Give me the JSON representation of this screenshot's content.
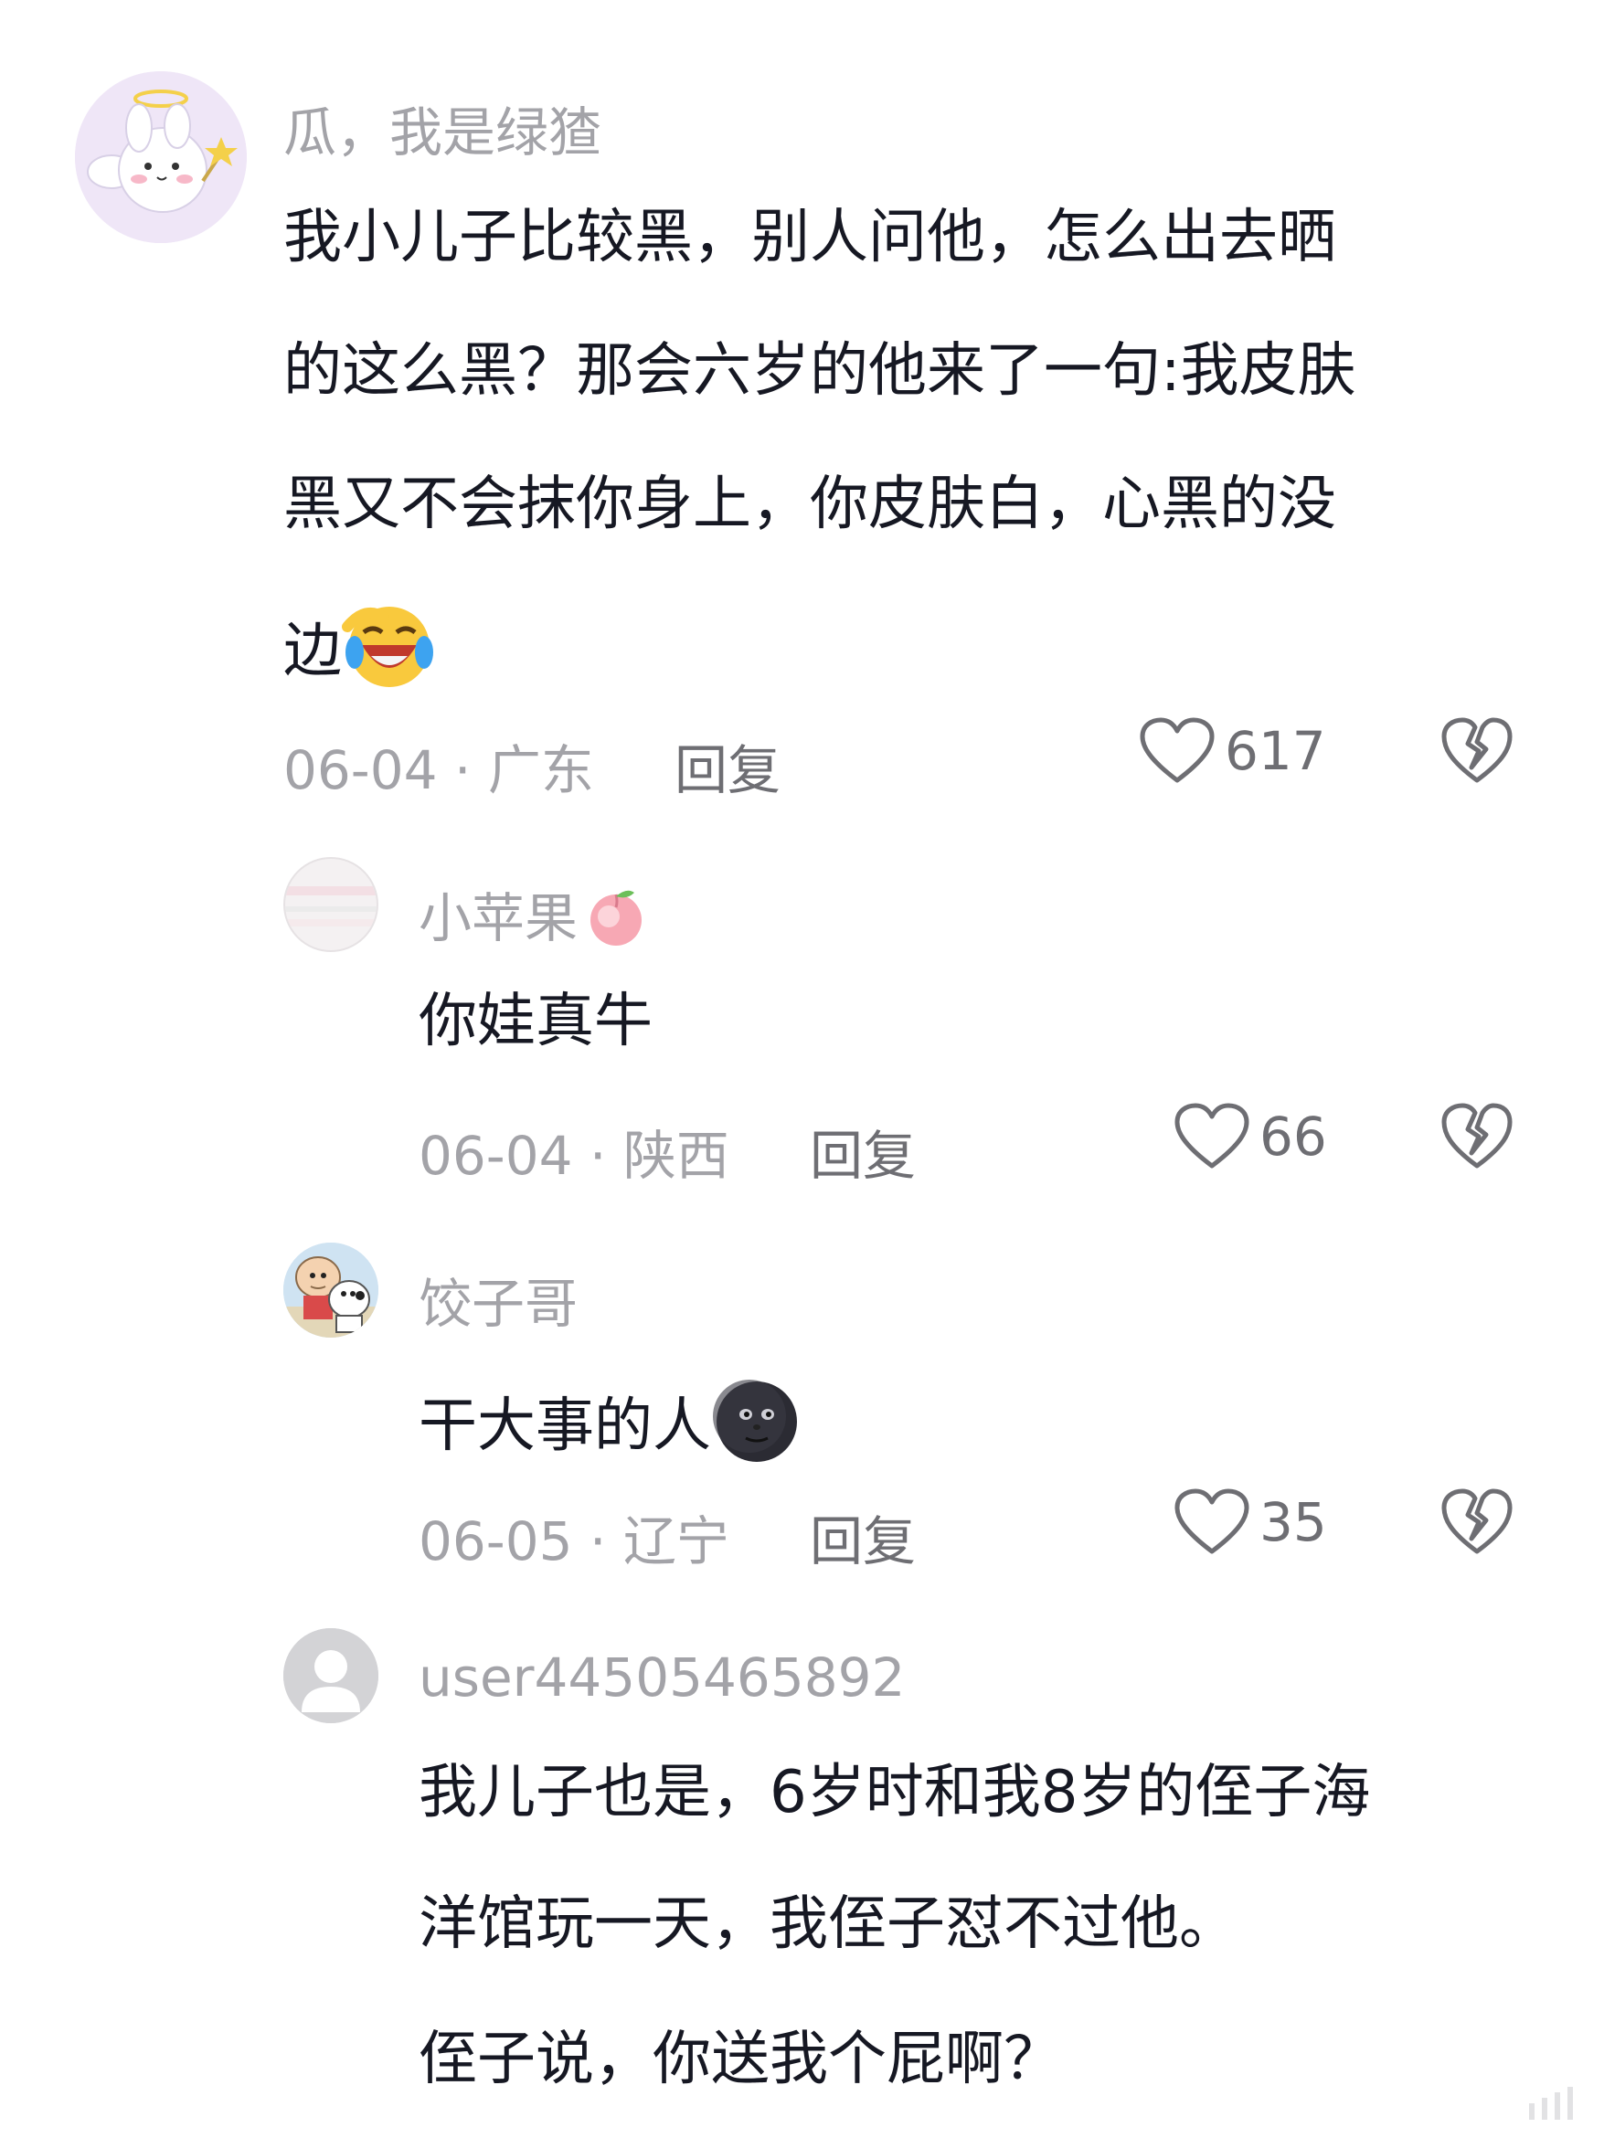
{
  "comments": [
    {
      "username": "瓜，我是绿猹",
      "lines": [
        "我小儿子比较黑，别人问他，怎么出去晒",
        "的这么黑？那会六岁的他来了一句:我皮肤",
        "黑又不会抹你身上，你皮肤白，心黑的没",
        "边"
      ],
      "emoji": "laughing-crying-emoji",
      "date": "06-04",
      "location": "广东",
      "reply_label": "回复",
      "likes": "617"
    },
    {
      "username": "小苹果",
      "username_emoji": "peach-emoji",
      "lines": [
        "你娃真牛"
      ],
      "date": "06-04",
      "location": "陕西",
      "reply_label": "回复",
      "likes": "66"
    },
    {
      "username": "饺子哥",
      "lines": [
        "干大事的人"
      ],
      "emoji": "new-moon-face-emoji",
      "date": "06-05",
      "location": "辽宁",
      "reply_label": "回复",
      "likes": "35"
    },
    {
      "username": "user44505465892",
      "lines": [
        "我儿子也是，6岁时和我8岁的侄子海",
        "洋馆玩一天，我侄子怼不过他。",
        "侄子说，你送我个屁啊？"
      ]
    }
  ],
  "separator": "·",
  "colors": {
    "text": "#161823",
    "meta": "#a3a3a8",
    "action": "#6e6e73",
    "background": "#ffffff"
  },
  "icons": {
    "like": "heart-outline-icon",
    "dislike": "broken-heart-icon"
  }
}
